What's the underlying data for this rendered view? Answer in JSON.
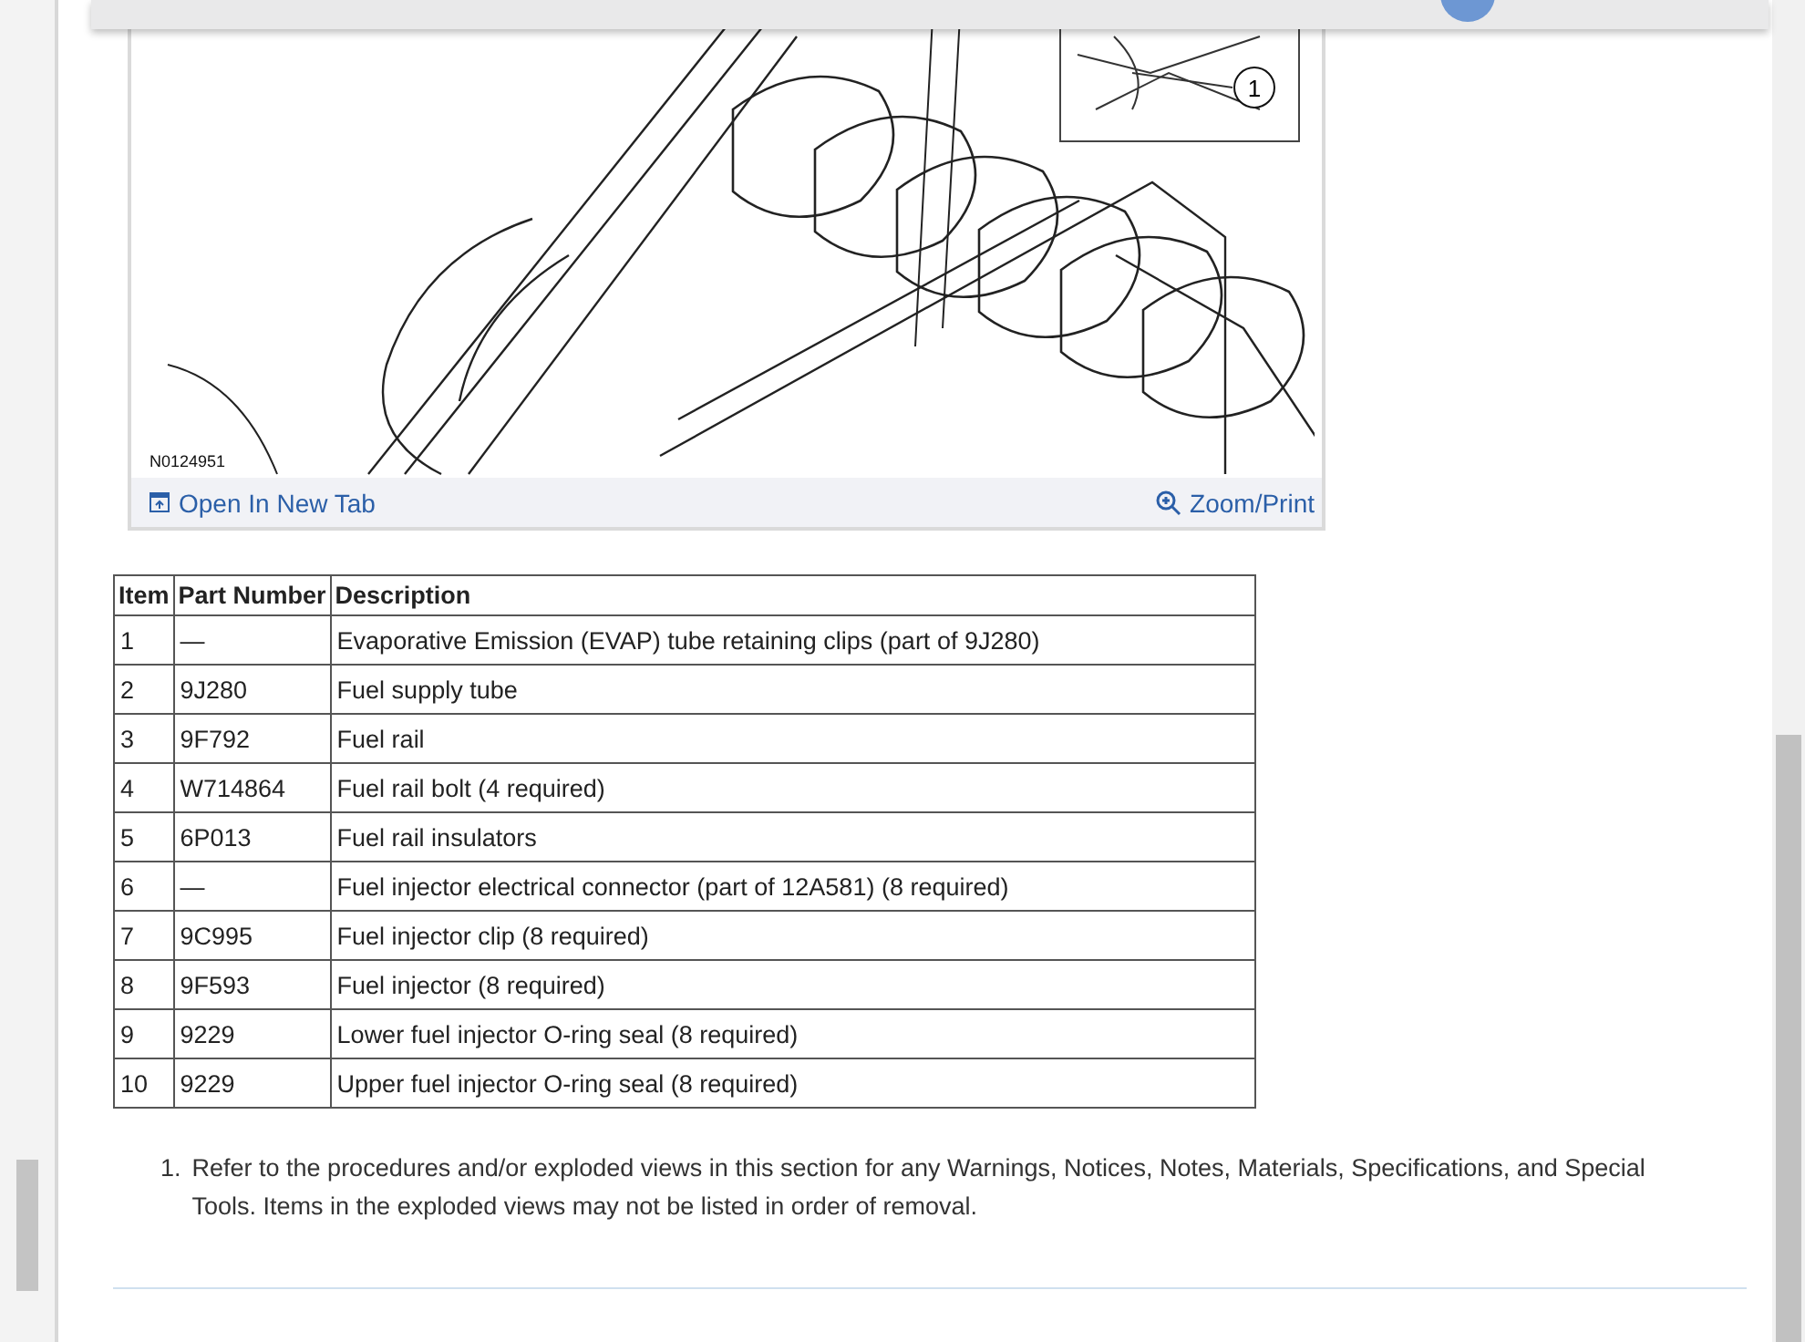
{
  "figure": {
    "caption": "N0124951",
    "callout": "1",
    "links": [
      {
        "kind": "open",
        "label": "Open In New Tab"
      },
      {
        "kind": "zoom",
        "label": "Zoom/Print"
      }
    ]
  },
  "table": {
    "columns": [
      "Item",
      "Part Number",
      "Description"
    ],
    "rows": [
      [
        "1",
        "—",
        "Evaporative Emission (EVAP) tube retaining clips (part of 9J280)"
      ],
      [
        "2",
        "9J280",
        "Fuel supply tube"
      ],
      [
        "3",
        "9F792",
        "Fuel rail"
      ],
      [
        "4",
        "W714864",
        "Fuel rail bolt (4 required)"
      ],
      [
        "5",
        "6P013",
        "Fuel rail insulators"
      ],
      [
        "6",
        "—",
        "Fuel injector electrical connector (part of 12A581) (8 required)"
      ],
      [
        "7",
        "9C995",
        "Fuel injector clip (8 required)"
      ],
      [
        "8",
        "9F593",
        "Fuel injector (8 required)"
      ],
      [
        "9",
        "9229",
        "Lower fuel injector O-ring seal (8 required)"
      ],
      [
        "10",
        "9229",
        "Upper fuel injector O-ring seal (8 required)"
      ]
    ]
  },
  "notes": [
    {
      "number": "1.",
      "text": "Refer to the procedures and/or exploded views in this section for any Warnings, Notices, Notes, Materials, Specifications, and Special Tools. Items in the exploded views may not be listed in order of removal."
    }
  ]
}
